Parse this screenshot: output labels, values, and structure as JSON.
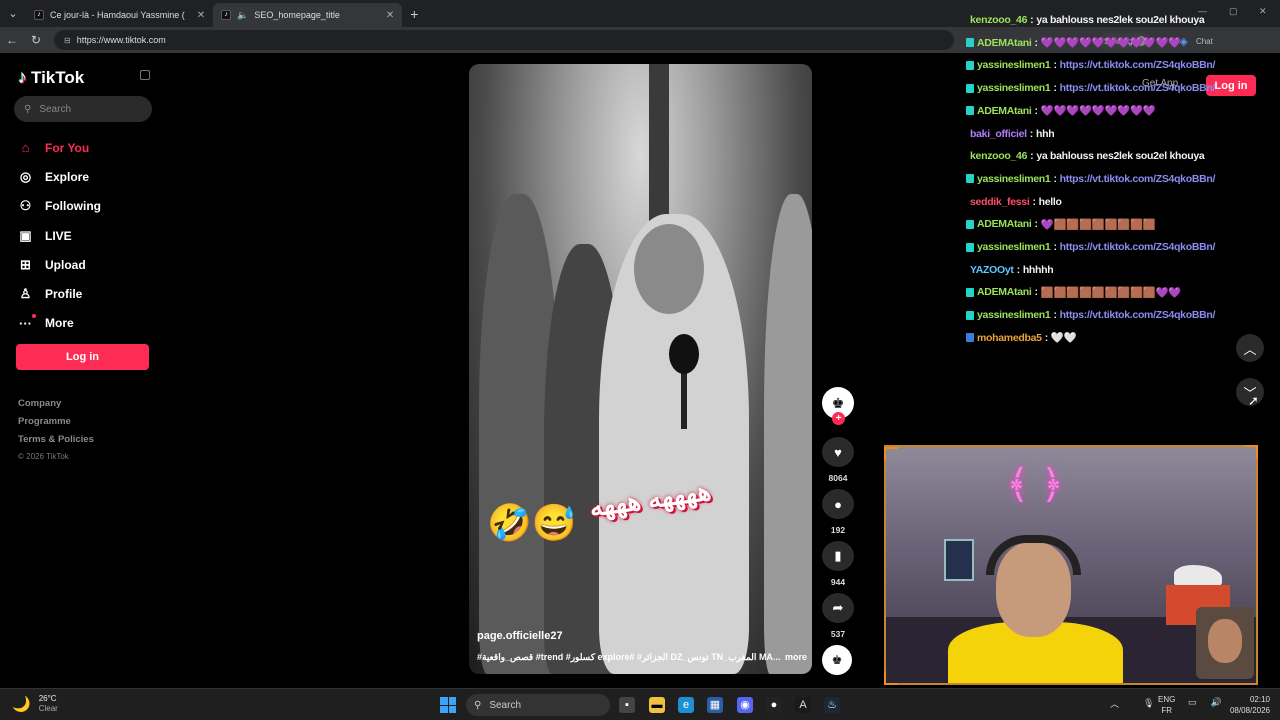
{
  "browser": {
    "tabs": [
      {
        "label": "Ce jour-là - Hamdaoui Yassmine (",
        "active": false
      },
      {
        "label": "SEO_homepage_title",
        "active": true
      }
    ],
    "url": "https://www.tiktok.com",
    "sync_label": "Syncing",
    "chat_label": "Chat"
  },
  "sidebar": {
    "logo": "TikTok",
    "search_placeholder": "Search",
    "nav": [
      {
        "label": "For You",
        "icon": "home-icon",
        "active": true
      },
      {
        "label": "Explore",
        "icon": "compass-icon",
        "active": false
      },
      {
        "label": "Following",
        "icon": "following-icon",
        "active": false
      },
      {
        "label": "LIVE",
        "icon": "live-icon",
        "active": false
      },
      {
        "label": "Upload",
        "icon": "upload-icon",
        "active": false
      },
      {
        "label": "Profile",
        "icon": "profile-icon",
        "active": false
      },
      {
        "label": "More",
        "icon": "more-icon",
        "active": false
      }
    ],
    "login_label": "Log in",
    "footer": [
      "Company",
      "Programme",
      "Terms & Policies"
    ],
    "copyright": "© 2026 TikTok"
  },
  "video": {
    "overlay_text": "ههههه هههه",
    "emojis": "🤣😅",
    "username": "page.officielle27",
    "description": "#قصص_واقعية #trend #كسلور explore# #الجزائر DZ_تونس TN_المغرب MA...",
    "more_label": "more"
  },
  "actions": {
    "likes": "8064",
    "comments": "192",
    "saves": "944",
    "shares": "537"
  },
  "header_right": {
    "get_app": "Get App",
    "login_label": "Log in"
  },
  "chat": [
    {
      "user": "kenzooo_46",
      "color": "#9be35a",
      "badge": false,
      "msg": "ya bahlouss nes2lek sou2el khouya",
      "type": "text"
    },
    {
      "user": "ADEMAtani",
      "color": "#9be35a",
      "badge": true,
      "msg": "💜💜💜💜💜💜💜💜💜💜💜",
      "type": "emote-purple"
    },
    {
      "user": "yassineslimen1",
      "color": "#9be35a",
      "badge": true,
      "msg": "https://vt.tiktok.com/ZS4qkoBBn/",
      "type": "link"
    },
    {
      "user": "yassineslimen1",
      "color": "#9be35a",
      "badge": true,
      "msg": "https://vt.tiktok.com/ZS4qkoBBn/",
      "type": "link"
    },
    {
      "user": "ADEMAtani",
      "color": "#9be35a",
      "badge": true,
      "msg": "💜💜💜💜💜💜💜💜💜",
      "type": "emote-purple"
    },
    {
      "user": "baki_officiel",
      "color": "#b57bff",
      "badge": false,
      "msg": "hhh",
      "type": "text"
    },
    {
      "user": "kenzooo_46",
      "color": "#9be35a",
      "badge": false,
      "msg": "ya bahlouss nes2lek sou2el khouya",
      "type": "text"
    },
    {
      "user": "yassineslimen1",
      "color": "#9be35a",
      "badge": true,
      "msg": "https://vt.tiktok.com/ZS4qkoBBn/",
      "type": "link"
    },
    {
      "user": "seddik_fessi",
      "color": "#ff4d6d",
      "badge": false,
      "msg": "hello",
      "type": "text"
    },
    {
      "user": "ADEMAtani",
      "color": "#9be35a",
      "badge": true,
      "msg": "💜🟫🟫🟫🟫🟫🟫🟫🟫",
      "type": "emote-box"
    },
    {
      "user": "yassineslimen1",
      "color": "#9be35a",
      "badge": true,
      "msg": "https://vt.tiktok.com/ZS4qkoBBn/",
      "type": "link"
    },
    {
      "user": "YAZOOyt",
      "color": "#5ec8ff",
      "badge": false,
      "msg": "hhhhh",
      "type": "text"
    },
    {
      "user": "ADEMAtani",
      "color": "#9be35a",
      "badge": true,
      "msg": "🟫🟫🟫🟫🟫🟫🟫🟫🟫💜💜",
      "type": "emote-box"
    },
    {
      "user": "yassineslimen1",
      "color": "#9be35a",
      "badge": true,
      "msg": "https://vt.tiktok.com/ZS4qkoBBn/",
      "type": "link"
    },
    {
      "user": "mohamedba5",
      "color": "#e9a23b",
      "badge": true,
      "msg": "🤍🤍",
      "type": "text"
    }
  ],
  "taskbar": {
    "temp": "26°C",
    "condition": "Clear",
    "search_placeholder": "Search",
    "lang_top": "ENG",
    "lang_bottom": "FR",
    "time": "02:10",
    "date": "08/08/2026"
  },
  "colors": {
    "tiktok_red": "#fe2c55",
    "chat_link": "#8a8cf0",
    "cam_border": "#c7852f"
  }
}
